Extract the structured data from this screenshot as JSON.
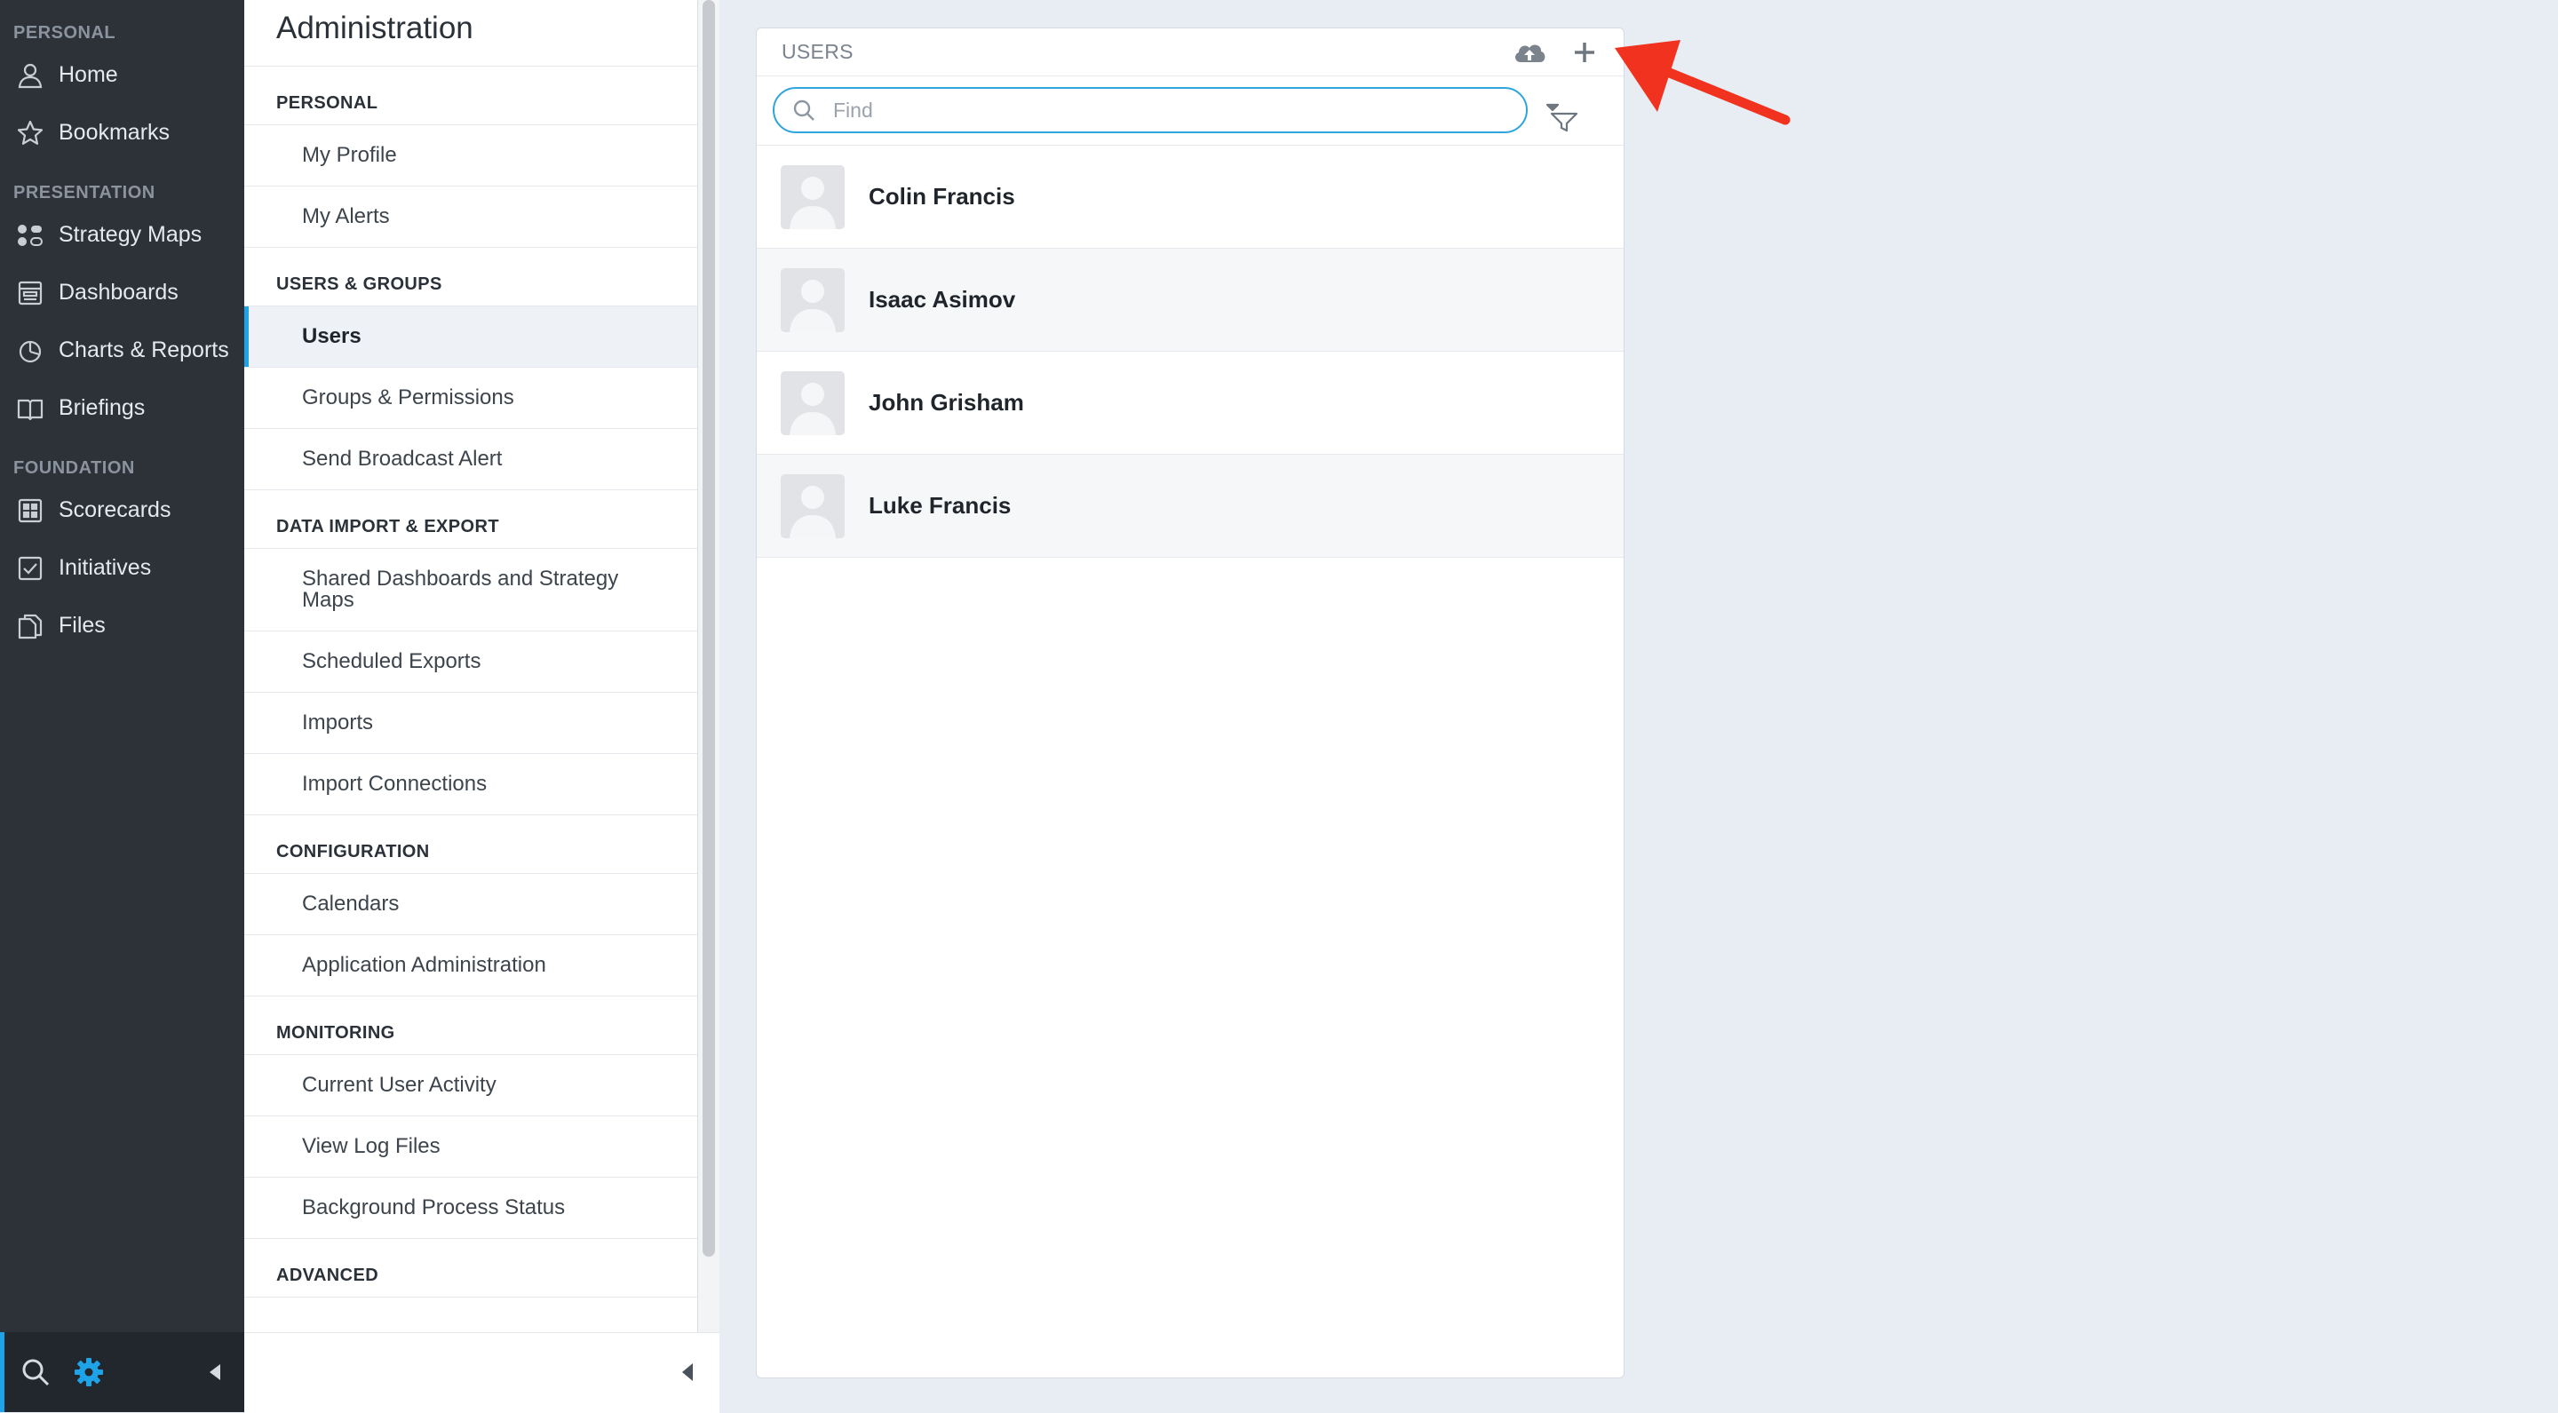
{
  "nav": {
    "sections": [
      {
        "title": "PERSONAL",
        "items": [
          {
            "label": "Home",
            "icon": "person-icon"
          },
          {
            "label": "Bookmarks",
            "icon": "star-icon"
          }
        ]
      },
      {
        "title": "PRESENTATION",
        "items": [
          {
            "label": "Strategy Maps",
            "icon": "strategy-map-icon"
          },
          {
            "label": "Dashboards",
            "icon": "dashboard-icon"
          },
          {
            "label": "Charts & Reports",
            "icon": "pie-chart-icon"
          },
          {
            "label": "Briefings",
            "icon": "book-icon"
          }
        ]
      },
      {
        "title": "FOUNDATION",
        "items": [
          {
            "label": "Scorecards",
            "icon": "scorecard-icon"
          },
          {
            "label": "Initiatives",
            "icon": "checkbox-icon"
          },
          {
            "label": "Files",
            "icon": "files-icon"
          }
        ]
      }
    ],
    "accent_color": "#1fa3e8"
  },
  "admin": {
    "title": "Administration",
    "groups": [
      {
        "title": "PERSONAL",
        "items": [
          "My Profile",
          "My Alerts"
        ]
      },
      {
        "title": "USERS & GROUPS",
        "items": [
          "Users",
          "Groups & Permissions",
          "Send Broadcast Alert"
        ]
      },
      {
        "title": "DATA IMPORT & EXPORT",
        "items": [
          "Shared Dashboards and Strategy Maps",
          "Scheduled Exports",
          "Imports",
          "Import Connections"
        ]
      },
      {
        "title": "CONFIGURATION",
        "items": [
          "Calendars",
          "Application Administration"
        ]
      },
      {
        "title": "MONITORING",
        "items": [
          "Current User Activity",
          "View Log Files",
          "Background Process Status"
        ]
      },
      {
        "title": "ADVANCED",
        "items": []
      }
    ],
    "active_item": "Users"
  },
  "users": {
    "header": "USERS",
    "search": {
      "placeholder": "Find",
      "value": ""
    },
    "list": [
      "Colin Francis",
      "Isaac Asimov",
      "John Grisham",
      "Luke Francis"
    ],
    "search_border_color": "#2ea4dc"
  },
  "annotation": {
    "arrow_color": "#f0321e"
  }
}
